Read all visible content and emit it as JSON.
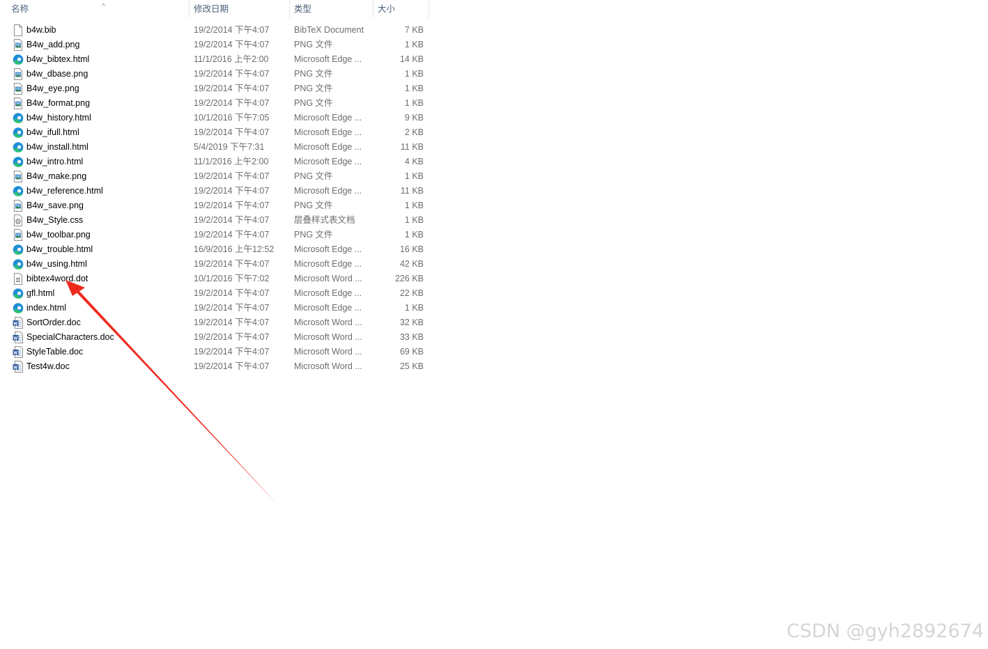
{
  "columns": {
    "name": "名称",
    "date": "修改日期",
    "type": "类型",
    "size": "大小"
  },
  "files": [
    {
      "name": "b4w.bib",
      "date": "19/2/2014 下午4:07",
      "type": "BibTeX Document",
      "size": "7 KB",
      "icon": "blank-file-icon"
    },
    {
      "name": "B4w_add.png",
      "date": "19/2/2014 下午4:07",
      "type": "PNG 文件",
      "size": "1 KB",
      "icon": "png-file-icon"
    },
    {
      "name": "b4w_bibtex.html",
      "date": "11/1/2016 上午2:00",
      "type": "Microsoft Edge ...",
      "size": "14 KB",
      "icon": "edge-icon"
    },
    {
      "name": "b4w_dbase.png",
      "date": "19/2/2014 下午4:07",
      "type": "PNG 文件",
      "size": "1 KB",
      "icon": "png-file-icon"
    },
    {
      "name": "B4w_eye.png",
      "date": "19/2/2014 下午4:07",
      "type": "PNG 文件",
      "size": "1 KB",
      "icon": "png-file-icon"
    },
    {
      "name": "B4w_format.png",
      "date": "19/2/2014 下午4:07",
      "type": "PNG 文件",
      "size": "1 KB",
      "icon": "png-file-icon"
    },
    {
      "name": "b4w_history.html",
      "date": "10/1/2016 下午7:05",
      "type": "Microsoft Edge ...",
      "size": "9 KB",
      "icon": "edge-icon"
    },
    {
      "name": "b4w_ifull.html",
      "date": "19/2/2014 下午4:07",
      "type": "Microsoft Edge ...",
      "size": "2 KB",
      "icon": "edge-icon"
    },
    {
      "name": "b4w_install.html",
      "date": "5/4/2019 下午7:31",
      "type": "Microsoft Edge ...",
      "size": "11 KB",
      "icon": "edge-icon"
    },
    {
      "name": "b4w_intro.html",
      "date": "11/1/2016 上午2:00",
      "type": "Microsoft Edge ...",
      "size": "4 KB",
      "icon": "edge-icon"
    },
    {
      "name": "B4w_make.png",
      "date": "19/2/2014 下午4:07",
      "type": "PNG 文件",
      "size": "1 KB",
      "icon": "png-file-icon"
    },
    {
      "name": "b4w_reference.html",
      "date": "19/2/2014 下午4:07",
      "type": "Microsoft Edge ...",
      "size": "11 KB",
      "icon": "edge-icon"
    },
    {
      "name": "B4w_save.png",
      "date": "19/2/2014 下午4:07",
      "type": "PNG 文件",
      "size": "1 KB",
      "icon": "png-file-icon"
    },
    {
      "name": "B4w_Style.css",
      "date": "19/2/2014 下午4:07",
      "type": "层叠样式表文档",
      "size": "1 KB",
      "icon": "css-file-icon"
    },
    {
      "name": "b4w_toolbar.png",
      "date": "19/2/2014 下午4:07",
      "type": "PNG 文件",
      "size": "1 KB",
      "icon": "png-file-icon"
    },
    {
      "name": "b4w_trouble.html",
      "date": "16/9/2016 上午12:52",
      "type": "Microsoft Edge ...",
      "size": "16 KB",
      "icon": "edge-icon"
    },
    {
      "name": "b4w_using.html",
      "date": "19/2/2014 下午4:07",
      "type": "Microsoft Edge ...",
      "size": "42 KB",
      "icon": "edge-icon"
    },
    {
      "name": "bibtex4word.dot",
      "date": "10/1/2016 下午7:02",
      "type": "Microsoft Word ...",
      "size": "226 KB",
      "icon": "dot-file-icon"
    },
    {
      "name": "gfl.html",
      "date": "19/2/2014 下午4:07",
      "type": "Microsoft Edge ...",
      "size": "22 KB",
      "icon": "edge-icon"
    },
    {
      "name": "index.html",
      "date": "19/2/2014 下午4:07",
      "type": "Microsoft Edge ...",
      "size": "1 KB",
      "icon": "edge-icon"
    },
    {
      "name": "SortOrder.doc",
      "date": "19/2/2014 下午4:07",
      "type": "Microsoft Word ...",
      "size": "32 KB",
      "icon": "word-doc-icon"
    },
    {
      "name": "SpecialCharacters.doc",
      "date": "19/2/2014 下午4:07",
      "type": "Microsoft Word ...",
      "size": "33 KB",
      "icon": "word-doc-icon"
    },
    {
      "name": "StyleTable.doc",
      "date": "19/2/2014 下午4:07",
      "type": "Microsoft Word ...",
      "size": "69 KB",
      "icon": "word-doc-icon"
    },
    {
      "name": "Test4w.doc",
      "date": "19/2/2014 下午4:07",
      "type": "Microsoft Word ...",
      "size": "25 KB",
      "icon": "word-doc-icon"
    }
  ],
  "annotation": {
    "color": "#ee2a1f"
  },
  "watermark": "CSDN @gyh2892674"
}
